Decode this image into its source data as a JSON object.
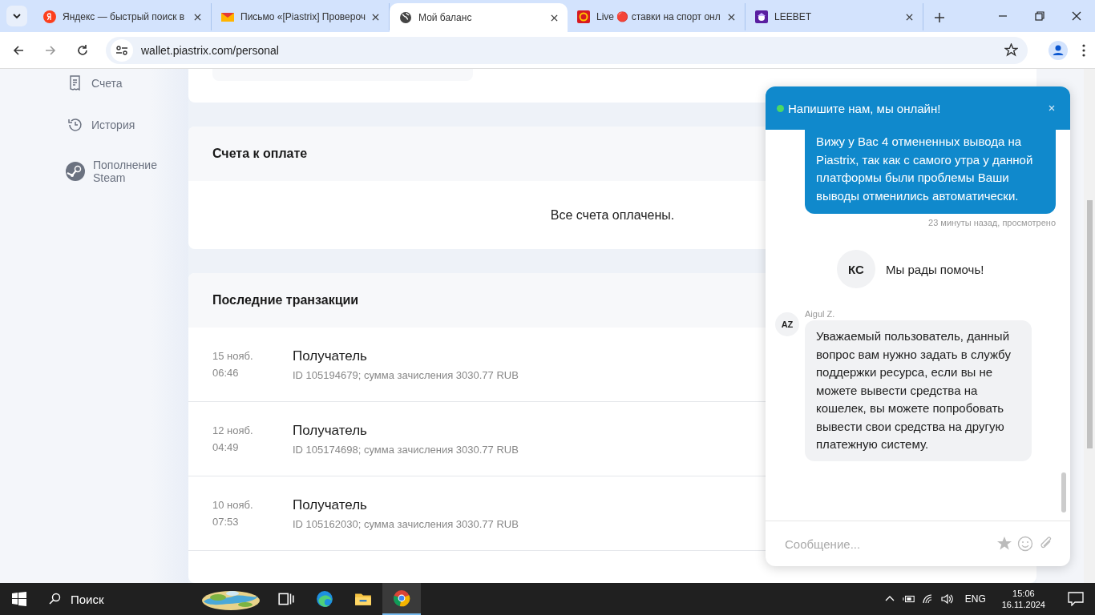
{
  "browser": {
    "tabs": [
      {
        "kind": "yandex",
        "title": "Яндекс — быстрый поиск в",
        "selected": false
      },
      {
        "kind": "mail",
        "title": "Письмо «[Piastrix] Провероч",
        "selected": false
      },
      {
        "kind": "globe",
        "title": "Мой баланс",
        "selected": true
      },
      {
        "kind": "live",
        "title": "Live 🔴 ставки на спорт онл",
        "selected": false
      },
      {
        "kind": "leebet",
        "title": "LEEBET",
        "selected": false
      }
    ],
    "address": "wallet.piastrix.com/personal"
  },
  "sidebar": {
    "items": [
      {
        "kind": "invoice",
        "label": "Счета"
      },
      {
        "kind": "history",
        "label": "История"
      },
      {
        "kind": "steam",
        "label": "Пополнение Steam"
      }
    ]
  },
  "invoices": {
    "title": "Счета к оплате",
    "empty_text": "Все счета оплачены."
  },
  "transactions": {
    "title": "Последние транзакции",
    "rows": [
      {
        "date": "15 нояб.",
        "time": "06:46",
        "title": "Получатель",
        "details": "ID 105194679; сумма зачисления 3030.77 RUB"
      },
      {
        "date": "12 нояб.",
        "time": "04:49",
        "title": "Получатель",
        "details": "ID 105174698; сумма зачисления 3030.77 RUB"
      },
      {
        "date": "10 нояб.",
        "time": "07:53",
        "title": "Получатель",
        "details": "ID 105162030; сумма зачисления 3030.77 RUB"
      }
    ]
  },
  "chat": {
    "title": "Напишите нам, мы онлайн!",
    "online": true,
    "messages": [
      {
        "kind": "outgoing",
        "text": "Вижу у Вас 4 отмененных вывода на Piastrix, так как с самого утра у данной платформы были проблемы Ваши выводы отменились автоматически.",
        "status": "23 минуты назад, просмотрено"
      },
      {
        "kind": "system",
        "avatar": "КС",
        "text": "Мы рады помочь!"
      },
      {
        "kind": "incoming",
        "avatar": "AZ",
        "author": "Aigul Z.",
        "text": "Уважаемый пользователь, данный вопрос вам нужно задать в службу поддержки ресурса, если вы не можете вывести средства на кошелек, вы можете попробовать вывести свои средства на другую платежную систему."
      }
    ],
    "placeholder": "Сообщение..."
  },
  "taskbar": {
    "search_placeholder": "Поиск",
    "apps": [
      {
        "kind": "taskview",
        "selected": false
      },
      {
        "kind": "edge",
        "selected": false
      },
      {
        "kind": "explorer",
        "selected": false
      },
      {
        "kind": "chrome",
        "selected": true
      }
    ],
    "language": "ENG",
    "time": "15:06",
    "date": "16.11.2024"
  }
}
